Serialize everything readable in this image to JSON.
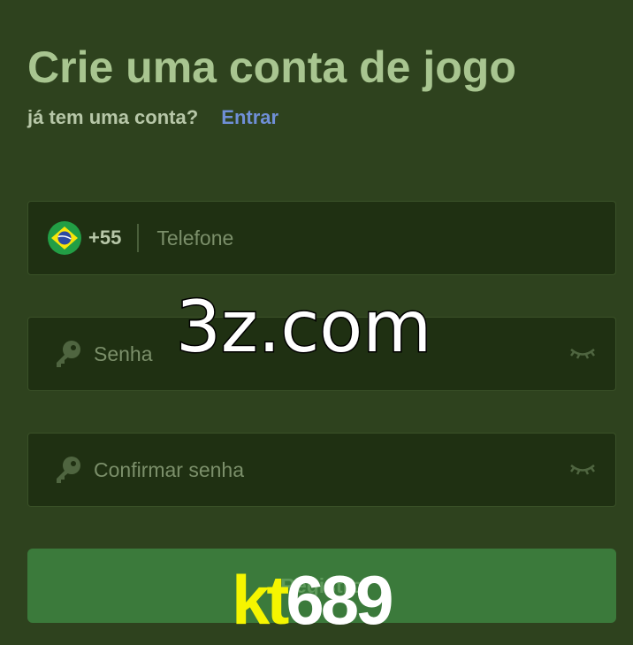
{
  "header": {
    "title": "Crie uma conta de jogo",
    "login_prompt": "já tem uma conta?",
    "login_link": "Entrar"
  },
  "form": {
    "phone": {
      "country_code": "+55",
      "placeholder": "Telefone",
      "flag_icon": "brazil-flag-icon"
    },
    "password": {
      "placeholder": "Senha",
      "icon": "key-icon",
      "toggle_icon": "eye-closed-icon"
    },
    "confirm_password": {
      "placeholder": "Confirmar senha",
      "icon": "key-icon",
      "toggle_icon": "eye-closed-icon"
    },
    "register_label": "Registro"
  },
  "overlays": {
    "watermark": "3z.com",
    "brand_part1": "kt",
    "brand_part2": "689"
  },
  "colors": {
    "background": "#2e421e",
    "field_background": "#1f3012",
    "title": "#a8c590",
    "link": "#6f8fd6",
    "button": "#3b7a3b",
    "brand_yellow": "#f5f500"
  }
}
